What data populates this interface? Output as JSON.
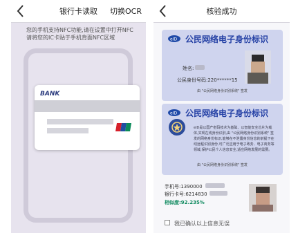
{
  "left_screen": {
    "title": "银行卡读取",
    "switch_label": "切换OCR",
    "instruction_line1": "您的手机支持NFC功能,请在设置中打开NFC",
    "instruction_line2": "请将您的IC卡贴于手机背面NFC区域",
    "card_brand": "BANK",
    "icons": [
      "back-arrow-icon",
      "unionpay-icon"
    ]
  },
  "right_screen": {
    "title": "核验成功",
    "id_card_title": "公民网络电子身份标识",
    "name_label": "姓名:",
    "id_number_label": "公民身份号码:220******15",
    "id_card_footer": "由 \"公民网络身份识别系统\" 签发",
    "id_back_description": "eID是以国产密码技术为基础、以智能安全芯片为载体,实现在线身份识别,由 \"公民网络身份识别系统\" 签发的网络身份标识,能够在不泄露身份信息的前提下在线远程识别身份,可广泛应用于电子政务、电子商务等领域,保护公民个人信息安全,适应网络发展的需要。",
    "id_back_footer": "由 \"公民网络身份识别系统\" 签发",
    "phone_label": "手机号:1390000",
    "bank_card_label": "银行卡号:6214830",
    "similarity_label": "相似度:92.235%",
    "confirm_text": "我已确认以上信息无误",
    "icons": [
      "back-arrow-icon",
      "eid-logo-icon",
      "seal-icon",
      "checkbox-icon"
    ]
  }
}
